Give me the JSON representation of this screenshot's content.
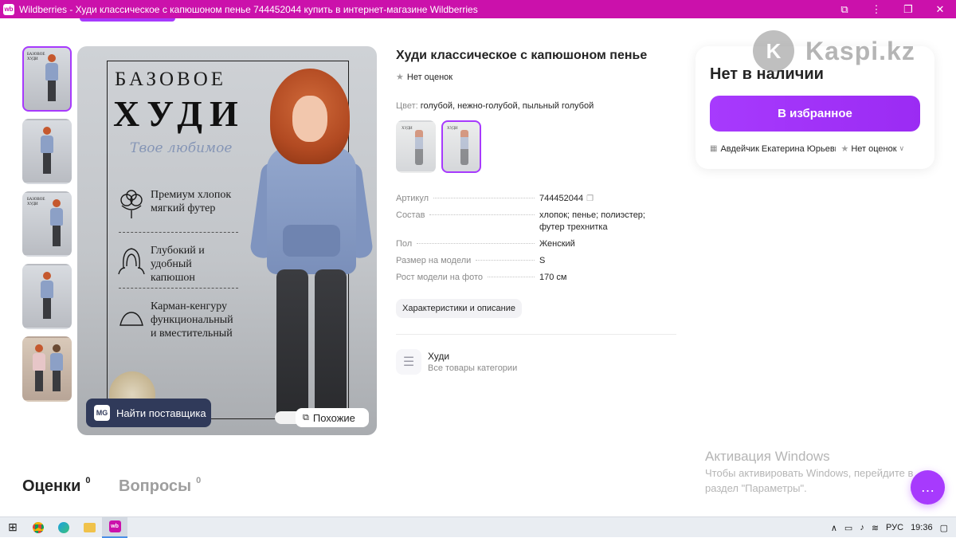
{
  "window": {
    "title": "Wildberries - Худи классическое с капюшоном пенье 744452044 купить в интернет-магазине Wildberries",
    "app_icon": "wb",
    "buttons": [
      "extensions-icon",
      "menu-icon",
      "restore-icon",
      "close-icon"
    ]
  },
  "gallery": {
    "thumbnails": [
      "thumb-1",
      "thumb-2",
      "thumb-3",
      "thumb-4",
      "thumb-5"
    ],
    "active_index": 0,
    "thumb_text": "БАЗОВОЕ\nХУДИ",
    "main": {
      "headline": "БАЗОВОЕ",
      "hoodie": "ХУДИ",
      "subtitle": "Твое любимое",
      "features": [
        {
          "icon": "cotton-icon",
          "text": "Премиум хлопок\nмягкий футер"
        },
        {
          "icon": "hood-icon",
          "text": "Глубокий и\nудобный\nкапюшон"
        },
        {
          "icon": "pocket-icon",
          "text": "Карман-кенгуру\nфункциональный\nи вместительный"
        }
      ]
    },
    "find_supplier": {
      "badge": "MG",
      "label": "Найти поставщика"
    },
    "similar": {
      "label": "Похожие"
    }
  },
  "product": {
    "title": "Худи классическое с капюшоном пенье",
    "rating_text": "Нет оценок",
    "color_label": "Цвет:",
    "color_value": "голубой, нежно-голубой, пыльный голубой",
    "swatch_selected_index": 1,
    "props": [
      {
        "key": "Артикул",
        "value": "744452044",
        "copy": true
      },
      {
        "key": "Состав",
        "value": "хлопок; пенье; полиэстер; футер трехнитка"
      },
      {
        "key": "Пол",
        "value": "Женский"
      },
      {
        "key": "Размер на модели",
        "value": "S"
      },
      {
        "key": "Рост модели на фото",
        "value": "170 см"
      }
    ],
    "chars_button": "Характеристики и описание",
    "category": {
      "name": "Худи",
      "sub": "Все товары категории"
    }
  },
  "buy": {
    "status": "Нет в наличии",
    "fav_button": "В избранное",
    "seller_name": "Авдейчик Екатерина Юрьевна",
    "seller_rating": "Нет оценок"
  },
  "watermark": {
    "logo_letter": "K",
    "text": "Kaspi.kz"
  },
  "tabs": {
    "reviews": "Оценки",
    "reviews_count": "0",
    "questions": "Вопросы",
    "questions_count": "0"
  },
  "activation": {
    "title": "Активация Windows",
    "line1": "Чтобы активировать Windows, перейдите в",
    "line2": "раздел \"Параметры\"."
  },
  "taskbar": {
    "lang": "РУС",
    "time": "19:36"
  },
  "colors": {
    "brand": "#cb11ab",
    "accent": "#a73afd",
    "supplier_btn": "#303a5a"
  }
}
